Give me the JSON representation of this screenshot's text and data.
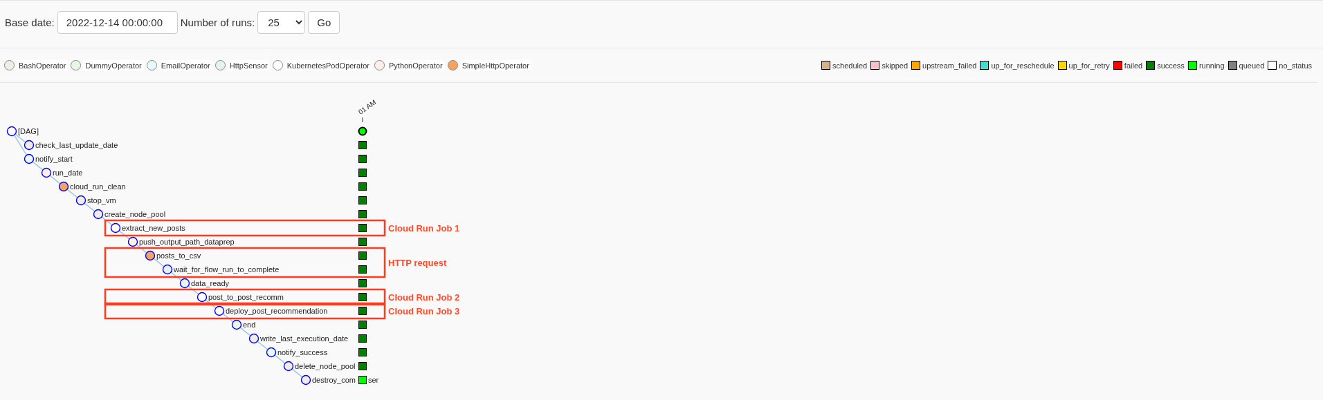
{
  "controls": {
    "base_date_label": "Base date:",
    "base_date": "2022-12-14 00:00:00",
    "runs_label": "Number of runs:",
    "runs": "25",
    "go": "Go"
  },
  "operators": [
    {
      "name": "BashOperator",
      "color": "#f0ede4"
    },
    {
      "name": "DummyOperator",
      "color": "#e8f7e4"
    },
    {
      "name": "EmailOperator",
      "color": "#e6faf9"
    },
    {
      "name": "HttpSensor",
      "color": "#e6f1f2"
    },
    {
      "name": "KubernetesPodOperator",
      "color": "#ffffff"
    },
    {
      "name": "PythonOperator",
      "color": "#ffefeb"
    },
    {
      "name": "SimpleHttpOperator",
      "color": "#f4a460"
    }
  ],
  "states": [
    {
      "name": "scheduled",
      "color": "#d2b48c"
    },
    {
      "name": "skipped",
      "color": "#ffc0cb"
    },
    {
      "name": "upstream_failed",
      "color": "#ffa500"
    },
    {
      "name": "up_for_reschedule",
      "color": "#40e0d0"
    },
    {
      "name": "up_for_retry",
      "color": "#ffd700"
    },
    {
      "name": "failed",
      "color": "#ff0000"
    },
    {
      "name": "success",
      "color": "#008000"
    },
    {
      "name": "running",
      "color": "#00ff00"
    },
    {
      "name": "queued",
      "color": "#808080"
    },
    {
      "name": "no_status",
      "color": "#ffffff"
    }
  ],
  "run_column": {
    "label": "01 AM",
    "status": {
      "color": "#00ff00"
    }
  },
  "tree": {
    "label": "[DAG]",
    "color": "#ffffff",
    "children": [
      {
        "label": "check_last_update_date",
        "color": "#f0ede4",
        "status": {
          "color": "#008000"
        }
      },
      {
        "label": "notify_start",
        "color": "#e6faf9",
        "status": {
          "color": "#008000"
        },
        "children": [
          {
            "label": "run_date",
            "color": "#ffefeb",
            "status": {
              "color": "#008000"
            },
            "children": [
              {
                "label": "cloud_run_clean",
                "color": "#f4a460",
                "status": {
                  "color": "#008000"
                },
                "children": [
                  {
                    "label": "stop_vm",
                    "color": "#f0ede4",
                    "status": {
                      "color": "#008000"
                    },
                    "children": [
                      {
                        "label": "create_node_pool",
                        "color": "#f0ede4",
                        "status": {
                          "color": "#008000"
                        },
                        "children": [
                          {
                            "label": "extract_new_posts",
                            "color": "#ffffff",
                            "status": {
                              "color": "#008000"
                            },
                            "callout": "Cloud Run Job 1",
                            "children": [
                              {
                                "label": "push_output_path_dataprep",
                                "color": "#ffefeb",
                                "status": {
                                  "color": "#008000"
                                },
                                "children": [
                                  {
                                    "label": "posts_to_csv",
                                    "color": "#f4a460",
                                    "status": {
                                      "color": "#008000"
                                    },
                                    "callout": "HTTP request",
                                    "children": [
                                      {
                                        "label": "wait_for_flow_run_to_complete",
                                        "color": "#e6f1f2",
                                        "status": {
                                          "color": "#008000"
                                        },
                                        "callout_continued": true,
                                        "children": [
                                          {
                                            "label": "data_ready",
                                            "color": "#e8f7e4",
                                            "status": {
                                              "color": "#008000"
                                            },
                                            "children": [
                                              {
                                                "label": "post_to_post_recomm",
                                                "color": "#ffffff",
                                                "status": {
                                                  "color": "#008000"
                                                },
                                                "callout": "Cloud Run Job 2",
                                                "children": [
                                                  {
                                                    "label": "deploy_post_recommendation",
                                                    "color": "#ffffff",
                                                    "status": {
                                                      "color": "#008000"
                                                    },
                                                    "callout": "Cloud Run Job 3",
                                                    "children": [
                                                      {
                                                        "label": "end",
                                                        "color": "#e8f7e4",
                                                        "status": {
                                                          "color": "#008000"
                                                        },
                                                        "children": [
                                                          {
                                                            "label": "write_last_execution_date",
                                                            "color": "#f0ede4",
                                                            "status": {
                                                              "color": "#008000"
                                                            },
                                                            "children": [
                                                              {
                                                                "label": "notify_success",
                                                                "color": "#e6faf9",
                                                                "status": {
                                                                  "color": "#008000"
                                                                },
                                                                "children": [
                                                                  {
                                                                    "label": "delete_node_pool",
                                                                    "color": "#f0ede4",
                                                                    "status": {
                                                                      "color": "#008000"
                                                                    },
                                                                    "children": [
                                                                      {
                                                                        "label": "destroy_com",
                                                                        "label_after": "ser",
                                                                        "color": "#f0ede4",
                                                                        "status": {
                                                                          "color": "#00ff00"
                                                                        }
                                                                      }
                                                                    ]
                                                                  }
                                                                ]
                                                              }
                                                            ]
                                                          }
                                                        ]
                                                      }
                                                    ]
                                                  }
                                                ]
                                              }
                                            ]
                                          }
                                        ]
                                      }
                                    ]
                                  }
                                ]
                              }
                            ]
                          }
                        ]
                      }
                    ]
                  }
                ]
              }
            ]
          }
        ]
      }
    ]
  }
}
